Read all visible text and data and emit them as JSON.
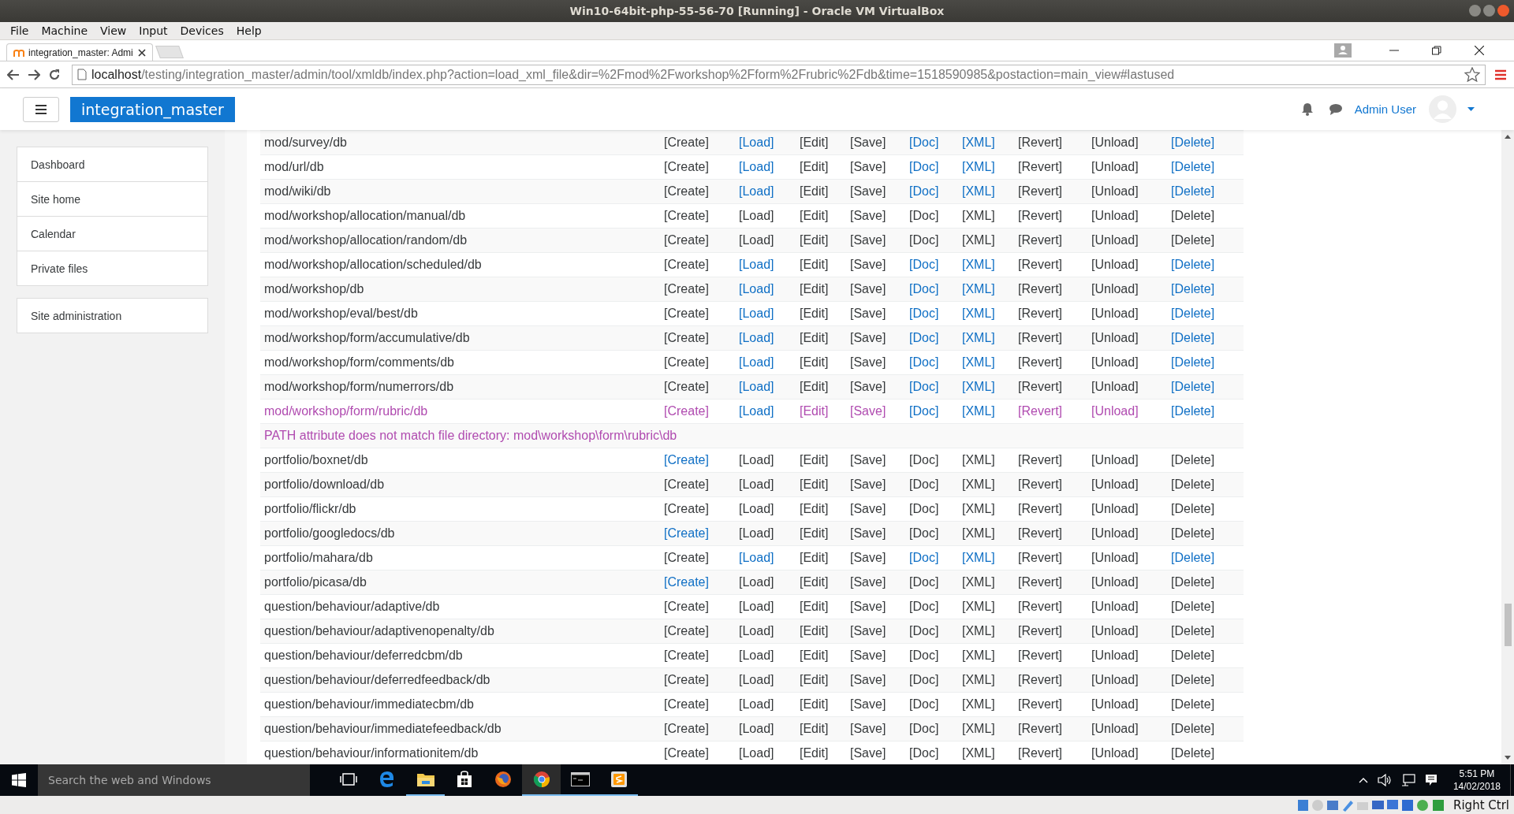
{
  "vm_window": {
    "title": "Win10-64bit-php-55-56-70 [Running] - Oracle VM VirtualBox",
    "menu": [
      "File",
      "Machine",
      "View",
      "Input",
      "Devices",
      "Help"
    ]
  },
  "browser": {
    "tab_title": "integration_master: Admi",
    "url_host": "localhost",
    "url_path": "/testing/integration_master/admin/tool/xmldb/index.php?action=load_xml_file&dir=%2Fmod%2Fworkshop%2Fform%2Frubric%2Fdb&time=1518590985&postaction=main_view#lastused"
  },
  "navbar": {
    "site_name": "integration_master",
    "user_name": "Admin User"
  },
  "sidebar": {
    "groups": [
      {
        "items": [
          {
            "label": "Dashboard"
          },
          {
            "label": "Site home"
          },
          {
            "label": "Calendar"
          },
          {
            "label": "Private files"
          }
        ]
      },
      {
        "items": [
          {
            "label": "Site administration"
          }
        ]
      }
    ]
  },
  "table": {
    "rows": [
      {
        "kind": "folder",
        "path": "mod/survey/db",
        "visited": false,
        "actions": [
          {
            "label": "[Create]",
            "link": false,
            "visited": false
          },
          {
            "label": "[Load]",
            "link": true,
            "visited": false
          },
          {
            "label": "[Edit]",
            "link": false,
            "visited": false
          },
          {
            "label": "[Save]",
            "link": false,
            "visited": false
          },
          {
            "label": "[Doc]",
            "link": true,
            "visited": false
          },
          {
            "label": "[XML]",
            "link": true,
            "visited": false
          },
          {
            "label": "[Revert]",
            "link": false,
            "visited": false
          },
          {
            "label": "[Unload]",
            "link": false,
            "visited": false
          },
          {
            "label": "[Delete]",
            "link": true,
            "visited": false
          }
        ]
      },
      {
        "kind": "folder",
        "path": "mod/url/db",
        "visited": false,
        "actions": [
          {
            "label": "[Create]",
            "link": false,
            "visited": false
          },
          {
            "label": "[Load]",
            "link": true,
            "visited": false
          },
          {
            "label": "[Edit]",
            "link": false,
            "visited": false
          },
          {
            "label": "[Save]",
            "link": false,
            "visited": false
          },
          {
            "label": "[Doc]",
            "link": true,
            "visited": false
          },
          {
            "label": "[XML]",
            "link": true,
            "visited": false
          },
          {
            "label": "[Revert]",
            "link": false,
            "visited": false
          },
          {
            "label": "[Unload]",
            "link": false,
            "visited": false
          },
          {
            "label": "[Delete]",
            "link": true,
            "visited": false
          }
        ]
      },
      {
        "kind": "folder",
        "path": "mod/wiki/db",
        "visited": false,
        "actions": [
          {
            "label": "[Create]",
            "link": false,
            "visited": false
          },
          {
            "label": "[Load]",
            "link": true,
            "visited": false
          },
          {
            "label": "[Edit]",
            "link": false,
            "visited": false
          },
          {
            "label": "[Save]",
            "link": false,
            "visited": false
          },
          {
            "label": "[Doc]",
            "link": true,
            "visited": false
          },
          {
            "label": "[XML]",
            "link": true,
            "visited": false
          },
          {
            "label": "[Revert]",
            "link": false,
            "visited": false
          },
          {
            "label": "[Unload]",
            "link": false,
            "visited": false
          },
          {
            "label": "[Delete]",
            "link": true,
            "visited": false
          }
        ]
      },
      {
        "kind": "folder",
        "path": "mod/workshop/allocation/manual/db",
        "visited": false,
        "actions": [
          {
            "label": "[Create]",
            "link": false,
            "visited": false
          },
          {
            "label": "[Load]",
            "link": false,
            "visited": false
          },
          {
            "label": "[Edit]",
            "link": false,
            "visited": false
          },
          {
            "label": "[Save]",
            "link": false,
            "visited": false
          },
          {
            "label": "[Doc]",
            "link": false,
            "visited": false
          },
          {
            "label": "[XML]",
            "link": false,
            "visited": false
          },
          {
            "label": "[Revert]",
            "link": false,
            "visited": false
          },
          {
            "label": "[Unload]",
            "link": false,
            "visited": false
          },
          {
            "label": "[Delete]",
            "link": false,
            "visited": false
          }
        ]
      },
      {
        "kind": "folder",
        "path": "mod/workshop/allocation/random/db",
        "visited": false,
        "actions": [
          {
            "label": "[Create]",
            "link": false,
            "visited": false
          },
          {
            "label": "[Load]",
            "link": false,
            "visited": false
          },
          {
            "label": "[Edit]",
            "link": false,
            "visited": false
          },
          {
            "label": "[Save]",
            "link": false,
            "visited": false
          },
          {
            "label": "[Doc]",
            "link": false,
            "visited": false
          },
          {
            "label": "[XML]",
            "link": false,
            "visited": false
          },
          {
            "label": "[Revert]",
            "link": false,
            "visited": false
          },
          {
            "label": "[Unload]",
            "link": false,
            "visited": false
          },
          {
            "label": "[Delete]",
            "link": false,
            "visited": false
          }
        ]
      },
      {
        "kind": "folder",
        "path": "mod/workshop/allocation/scheduled/db",
        "visited": false,
        "actions": [
          {
            "label": "[Create]",
            "link": false,
            "visited": false
          },
          {
            "label": "[Load]",
            "link": true,
            "visited": false
          },
          {
            "label": "[Edit]",
            "link": false,
            "visited": false
          },
          {
            "label": "[Save]",
            "link": false,
            "visited": false
          },
          {
            "label": "[Doc]",
            "link": true,
            "visited": false
          },
          {
            "label": "[XML]",
            "link": true,
            "visited": false
          },
          {
            "label": "[Revert]",
            "link": false,
            "visited": false
          },
          {
            "label": "[Unload]",
            "link": false,
            "visited": false
          },
          {
            "label": "[Delete]",
            "link": true,
            "visited": false
          }
        ]
      },
      {
        "kind": "folder",
        "path": "mod/workshop/db",
        "visited": false,
        "actions": [
          {
            "label": "[Create]",
            "link": false,
            "visited": false
          },
          {
            "label": "[Load]",
            "link": true,
            "visited": false
          },
          {
            "label": "[Edit]",
            "link": false,
            "visited": false
          },
          {
            "label": "[Save]",
            "link": false,
            "visited": false
          },
          {
            "label": "[Doc]",
            "link": true,
            "visited": false
          },
          {
            "label": "[XML]",
            "link": true,
            "visited": false
          },
          {
            "label": "[Revert]",
            "link": false,
            "visited": false
          },
          {
            "label": "[Unload]",
            "link": false,
            "visited": false
          },
          {
            "label": "[Delete]",
            "link": true,
            "visited": false
          }
        ]
      },
      {
        "kind": "folder",
        "path": "mod/workshop/eval/best/db",
        "visited": false,
        "actions": [
          {
            "label": "[Create]",
            "link": false,
            "visited": false
          },
          {
            "label": "[Load]",
            "link": true,
            "visited": false
          },
          {
            "label": "[Edit]",
            "link": false,
            "visited": false
          },
          {
            "label": "[Save]",
            "link": false,
            "visited": false
          },
          {
            "label": "[Doc]",
            "link": true,
            "visited": false
          },
          {
            "label": "[XML]",
            "link": true,
            "visited": false
          },
          {
            "label": "[Revert]",
            "link": false,
            "visited": false
          },
          {
            "label": "[Unload]",
            "link": false,
            "visited": false
          },
          {
            "label": "[Delete]",
            "link": true,
            "visited": false
          }
        ]
      },
      {
        "kind": "folder",
        "path": "mod/workshop/form/accumulative/db",
        "visited": false,
        "actions": [
          {
            "label": "[Create]",
            "link": false,
            "visited": false
          },
          {
            "label": "[Load]",
            "link": true,
            "visited": false
          },
          {
            "label": "[Edit]",
            "link": false,
            "visited": false
          },
          {
            "label": "[Save]",
            "link": false,
            "visited": false
          },
          {
            "label": "[Doc]",
            "link": true,
            "visited": false
          },
          {
            "label": "[XML]",
            "link": true,
            "visited": false
          },
          {
            "label": "[Revert]",
            "link": false,
            "visited": false
          },
          {
            "label": "[Unload]",
            "link": false,
            "visited": false
          },
          {
            "label": "[Delete]",
            "link": true,
            "visited": false
          }
        ]
      },
      {
        "kind": "folder",
        "path": "mod/workshop/form/comments/db",
        "visited": false,
        "actions": [
          {
            "label": "[Create]",
            "link": false,
            "visited": false
          },
          {
            "label": "[Load]",
            "link": true,
            "visited": false
          },
          {
            "label": "[Edit]",
            "link": false,
            "visited": false
          },
          {
            "label": "[Save]",
            "link": false,
            "visited": false
          },
          {
            "label": "[Doc]",
            "link": true,
            "visited": false
          },
          {
            "label": "[XML]",
            "link": true,
            "visited": false
          },
          {
            "label": "[Revert]",
            "link": false,
            "visited": false
          },
          {
            "label": "[Unload]",
            "link": false,
            "visited": false
          },
          {
            "label": "[Delete]",
            "link": true,
            "visited": false
          }
        ]
      },
      {
        "kind": "folder",
        "path": "mod/workshop/form/numerrors/db",
        "visited": false,
        "actions": [
          {
            "label": "[Create]",
            "link": false,
            "visited": false
          },
          {
            "label": "[Load]",
            "link": true,
            "visited": false
          },
          {
            "label": "[Edit]",
            "link": false,
            "visited": false
          },
          {
            "label": "[Save]",
            "link": false,
            "visited": false
          },
          {
            "label": "[Doc]",
            "link": true,
            "visited": false
          },
          {
            "label": "[XML]",
            "link": true,
            "visited": false
          },
          {
            "label": "[Revert]",
            "link": false,
            "visited": false
          },
          {
            "label": "[Unload]",
            "link": false,
            "visited": false
          },
          {
            "label": "[Delete]",
            "link": true,
            "visited": false
          }
        ]
      },
      {
        "kind": "folder",
        "path": "mod/workshop/form/rubric/db",
        "visited": true,
        "actions": [
          {
            "label": "[Create]",
            "link": true,
            "visited": true
          },
          {
            "label": "[Load]",
            "link": true,
            "visited": false
          },
          {
            "label": "[Edit]",
            "link": true,
            "visited": true
          },
          {
            "label": "[Save]",
            "link": true,
            "visited": true
          },
          {
            "label": "[Doc]",
            "link": true,
            "visited": false
          },
          {
            "label": "[XML]",
            "link": true,
            "visited": false
          },
          {
            "label": "[Revert]",
            "link": true,
            "visited": true
          },
          {
            "label": "[Unload]",
            "link": true,
            "visited": true
          },
          {
            "label": "[Delete]",
            "link": true,
            "visited": false
          }
        ]
      },
      {
        "kind": "message",
        "text": "PATH attribute does not match file directory: mod\\workshop\\form\\rubric\\db"
      },
      {
        "kind": "folder",
        "path": "portfolio/boxnet/db",
        "visited": false,
        "actions": [
          {
            "label": "[Create]",
            "link": true,
            "visited": false
          },
          {
            "label": "[Load]",
            "link": false,
            "visited": false
          },
          {
            "label": "[Edit]",
            "link": false,
            "visited": false
          },
          {
            "label": "[Save]",
            "link": false,
            "visited": false
          },
          {
            "label": "[Doc]",
            "link": false,
            "visited": false
          },
          {
            "label": "[XML]",
            "link": false,
            "visited": false
          },
          {
            "label": "[Revert]",
            "link": false,
            "visited": false
          },
          {
            "label": "[Unload]",
            "link": false,
            "visited": false
          },
          {
            "label": "[Delete]",
            "link": false,
            "visited": false
          }
        ]
      },
      {
        "kind": "folder",
        "path": "portfolio/download/db",
        "visited": false,
        "actions": [
          {
            "label": "[Create]",
            "link": false,
            "visited": false
          },
          {
            "label": "[Load]",
            "link": false,
            "visited": false
          },
          {
            "label": "[Edit]",
            "link": false,
            "visited": false
          },
          {
            "label": "[Save]",
            "link": false,
            "visited": false
          },
          {
            "label": "[Doc]",
            "link": false,
            "visited": false
          },
          {
            "label": "[XML]",
            "link": false,
            "visited": false
          },
          {
            "label": "[Revert]",
            "link": false,
            "visited": false
          },
          {
            "label": "[Unload]",
            "link": false,
            "visited": false
          },
          {
            "label": "[Delete]",
            "link": false,
            "visited": false
          }
        ]
      },
      {
        "kind": "folder",
        "path": "portfolio/flickr/db",
        "visited": false,
        "actions": [
          {
            "label": "[Create]",
            "link": false,
            "visited": false
          },
          {
            "label": "[Load]",
            "link": false,
            "visited": false
          },
          {
            "label": "[Edit]",
            "link": false,
            "visited": false
          },
          {
            "label": "[Save]",
            "link": false,
            "visited": false
          },
          {
            "label": "[Doc]",
            "link": false,
            "visited": false
          },
          {
            "label": "[XML]",
            "link": false,
            "visited": false
          },
          {
            "label": "[Revert]",
            "link": false,
            "visited": false
          },
          {
            "label": "[Unload]",
            "link": false,
            "visited": false
          },
          {
            "label": "[Delete]",
            "link": false,
            "visited": false
          }
        ]
      },
      {
        "kind": "folder",
        "path": "portfolio/googledocs/db",
        "visited": false,
        "actions": [
          {
            "label": "[Create]",
            "link": true,
            "visited": false
          },
          {
            "label": "[Load]",
            "link": false,
            "visited": false
          },
          {
            "label": "[Edit]",
            "link": false,
            "visited": false
          },
          {
            "label": "[Save]",
            "link": false,
            "visited": false
          },
          {
            "label": "[Doc]",
            "link": false,
            "visited": false
          },
          {
            "label": "[XML]",
            "link": false,
            "visited": false
          },
          {
            "label": "[Revert]",
            "link": false,
            "visited": false
          },
          {
            "label": "[Unload]",
            "link": false,
            "visited": false
          },
          {
            "label": "[Delete]",
            "link": false,
            "visited": false
          }
        ]
      },
      {
        "kind": "folder",
        "path": "portfolio/mahara/db",
        "visited": false,
        "actions": [
          {
            "label": "[Create]",
            "link": false,
            "visited": false
          },
          {
            "label": "[Load]",
            "link": true,
            "visited": false
          },
          {
            "label": "[Edit]",
            "link": false,
            "visited": false
          },
          {
            "label": "[Save]",
            "link": false,
            "visited": false
          },
          {
            "label": "[Doc]",
            "link": true,
            "visited": false
          },
          {
            "label": "[XML]",
            "link": true,
            "visited": false
          },
          {
            "label": "[Revert]",
            "link": false,
            "visited": false
          },
          {
            "label": "[Unload]",
            "link": false,
            "visited": false
          },
          {
            "label": "[Delete]",
            "link": true,
            "visited": false
          }
        ]
      },
      {
        "kind": "folder",
        "path": "portfolio/picasa/db",
        "visited": false,
        "actions": [
          {
            "label": "[Create]",
            "link": true,
            "visited": false
          },
          {
            "label": "[Load]",
            "link": false,
            "visited": false
          },
          {
            "label": "[Edit]",
            "link": false,
            "visited": false
          },
          {
            "label": "[Save]",
            "link": false,
            "visited": false
          },
          {
            "label": "[Doc]",
            "link": false,
            "visited": false
          },
          {
            "label": "[XML]",
            "link": false,
            "visited": false
          },
          {
            "label": "[Revert]",
            "link": false,
            "visited": false
          },
          {
            "label": "[Unload]",
            "link": false,
            "visited": false
          },
          {
            "label": "[Delete]",
            "link": false,
            "visited": false
          }
        ]
      },
      {
        "kind": "folder",
        "path": "question/behaviour/adaptive/db",
        "visited": false,
        "actions": [
          {
            "label": "[Create]",
            "link": false,
            "visited": false
          },
          {
            "label": "[Load]",
            "link": false,
            "visited": false
          },
          {
            "label": "[Edit]",
            "link": false,
            "visited": false
          },
          {
            "label": "[Save]",
            "link": false,
            "visited": false
          },
          {
            "label": "[Doc]",
            "link": false,
            "visited": false
          },
          {
            "label": "[XML]",
            "link": false,
            "visited": false
          },
          {
            "label": "[Revert]",
            "link": false,
            "visited": false
          },
          {
            "label": "[Unload]",
            "link": false,
            "visited": false
          },
          {
            "label": "[Delete]",
            "link": false,
            "visited": false
          }
        ]
      },
      {
        "kind": "folder",
        "path": "question/behaviour/adaptivenopenalty/db",
        "visited": false,
        "actions": [
          {
            "label": "[Create]",
            "link": false,
            "visited": false
          },
          {
            "label": "[Load]",
            "link": false,
            "visited": false
          },
          {
            "label": "[Edit]",
            "link": false,
            "visited": false
          },
          {
            "label": "[Save]",
            "link": false,
            "visited": false
          },
          {
            "label": "[Doc]",
            "link": false,
            "visited": false
          },
          {
            "label": "[XML]",
            "link": false,
            "visited": false
          },
          {
            "label": "[Revert]",
            "link": false,
            "visited": false
          },
          {
            "label": "[Unload]",
            "link": false,
            "visited": false
          },
          {
            "label": "[Delete]",
            "link": false,
            "visited": false
          }
        ]
      },
      {
        "kind": "folder",
        "path": "question/behaviour/deferredcbm/db",
        "visited": false,
        "actions": [
          {
            "label": "[Create]",
            "link": false,
            "visited": false
          },
          {
            "label": "[Load]",
            "link": false,
            "visited": false
          },
          {
            "label": "[Edit]",
            "link": false,
            "visited": false
          },
          {
            "label": "[Save]",
            "link": false,
            "visited": false
          },
          {
            "label": "[Doc]",
            "link": false,
            "visited": false
          },
          {
            "label": "[XML]",
            "link": false,
            "visited": false
          },
          {
            "label": "[Revert]",
            "link": false,
            "visited": false
          },
          {
            "label": "[Unload]",
            "link": false,
            "visited": false
          },
          {
            "label": "[Delete]",
            "link": false,
            "visited": false
          }
        ]
      },
      {
        "kind": "folder",
        "path": "question/behaviour/deferredfeedback/db",
        "visited": false,
        "actions": [
          {
            "label": "[Create]",
            "link": false,
            "visited": false
          },
          {
            "label": "[Load]",
            "link": false,
            "visited": false
          },
          {
            "label": "[Edit]",
            "link": false,
            "visited": false
          },
          {
            "label": "[Save]",
            "link": false,
            "visited": false
          },
          {
            "label": "[Doc]",
            "link": false,
            "visited": false
          },
          {
            "label": "[XML]",
            "link": false,
            "visited": false
          },
          {
            "label": "[Revert]",
            "link": false,
            "visited": false
          },
          {
            "label": "[Unload]",
            "link": false,
            "visited": false
          },
          {
            "label": "[Delete]",
            "link": false,
            "visited": false
          }
        ]
      },
      {
        "kind": "folder",
        "path": "question/behaviour/immediatecbm/db",
        "visited": false,
        "actions": [
          {
            "label": "[Create]",
            "link": false,
            "visited": false
          },
          {
            "label": "[Load]",
            "link": false,
            "visited": false
          },
          {
            "label": "[Edit]",
            "link": false,
            "visited": false
          },
          {
            "label": "[Save]",
            "link": false,
            "visited": false
          },
          {
            "label": "[Doc]",
            "link": false,
            "visited": false
          },
          {
            "label": "[XML]",
            "link": false,
            "visited": false
          },
          {
            "label": "[Revert]",
            "link": false,
            "visited": false
          },
          {
            "label": "[Unload]",
            "link": false,
            "visited": false
          },
          {
            "label": "[Delete]",
            "link": false,
            "visited": false
          }
        ]
      },
      {
        "kind": "folder",
        "path": "question/behaviour/immediatefeedback/db",
        "visited": false,
        "actions": [
          {
            "label": "[Create]",
            "link": false,
            "visited": false
          },
          {
            "label": "[Load]",
            "link": false,
            "visited": false
          },
          {
            "label": "[Edit]",
            "link": false,
            "visited": false
          },
          {
            "label": "[Save]",
            "link": false,
            "visited": false
          },
          {
            "label": "[Doc]",
            "link": false,
            "visited": false
          },
          {
            "label": "[XML]",
            "link": false,
            "visited": false
          },
          {
            "label": "[Revert]",
            "link": false,
            "visited": false
          },
          {
            "label": "[Unload]",
            "link": false,
            "visited": false
          },
          {
            "label": "[Delete]",
            "link": false,
            "visited": false
          }
        ]
      },
      {
        "kind": "folder",
        "path": "question/behaviour/informationitem/db",
        "visited": false,
        "actions": [
          {
            "label": "[Create]",
            "link": false,
            "visited": false
          },
          {
            "label": "[Load]",
            "link": false,
            "visited": false
          },
          {
            "label": "[Edit]",
            "link": false,
            "visited": false
          },
          {
            "label": "[Save]",
            "link": false,
            "visited": false
          },
          {
            "label": "[Doc]",
            "link": false,
            "visited": false
          },
          {
            "label": "[XML]",
            "link": false,
            "visited": false
          },
          {
            "label": "[Revert]",
            "link": false,
            "visited": false
          },
          {
            "label": "[Unload]",
            "link": false,
            "visited": false
          },
          {
            "label": "[Delete]",
            "link": false,
            "visited": false
          }
        ]
      }
    ]
  },
  "taskbar": {
    "search_placeholder": "Search the web and Windows",
    "apps": [
      {
        "kind": "taskview",
        "running": false,
        "selected": false
      },
      {
        "kind": "edge",
        "running": false,
        "selected": false
      },
      {
        "kind": "folder",
        "running": true,
        "selected": false
      },
      {
        "kind": "store",
        "running": false,
        "selected": false
      },
      {
        "kind": "firefox",
        "running": false,
        "selected": false
      },
      {
        "kind": "chrome",
        "running": true,
        "selected": true
      },
      {
        "kind": "terminal",
        "running": true,
        "selected": false
      },
      {
        "kind": "editor",
        "running": true,
        "selected": false
      }
    ],
    "time": "5:51 PM",
    "date": "14/02/2018"
  },
  "vbox_status": {
    "host_key": "Right Ctrl"
  }
}
